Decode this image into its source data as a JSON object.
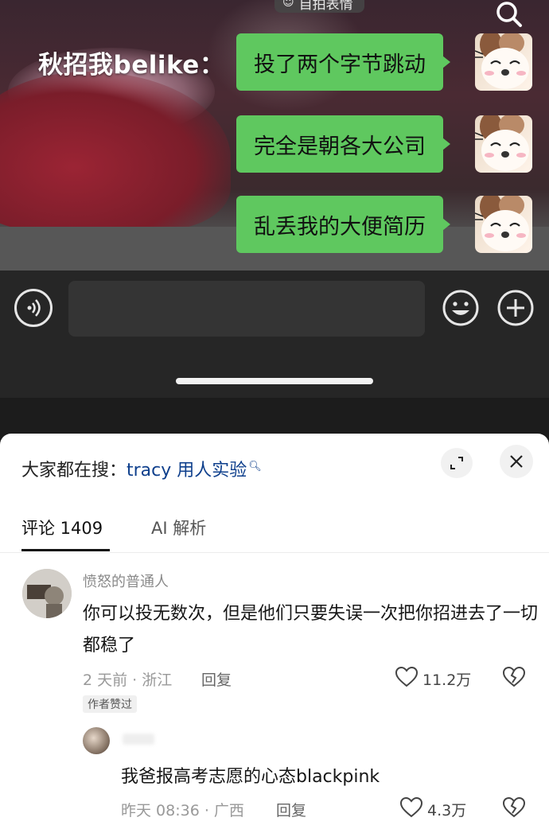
{
  "video": {
    "sticker_label": "自拍表情",
    "title": "秋招我belike：",
    "messages": [
      "投了两个字节跳动",
      "完全是朝各大公司",
      "乱丢我的大便简历"
    ]
  },
  "comments_panel": {
    "search_prefix": "大家都在搜：",
    "search_query": "tracy 用人实验",
    "tabs": [
      {
        "label": "评论 1409"
      },
      {
        "label": "AI 解析"
      }
    ],
    "comments": [
      {
        "username": "愤怒的普通人",
        "text": "你可以投无数次，但是他们只要失误一次把你招进去了一切都稳了",
        "meta": "2 天前 · 浙江",
        "reply_label": "回复",
        "likes": "11.2万",
        "badge": "作者赞过"
      }
    ],
    "replies": [
      {
        "text": "我爸报高考志愿的心态blackpink",
        "meta": "昨天 08:36 · 广西",
        "reply_label": "回复",
        "likes": "4.3万"
      }
    ]
  },
  "colors": {
    "bubble_green": "#5fc85f",
    "link_blue": "#0e3f8c"
  }
}
